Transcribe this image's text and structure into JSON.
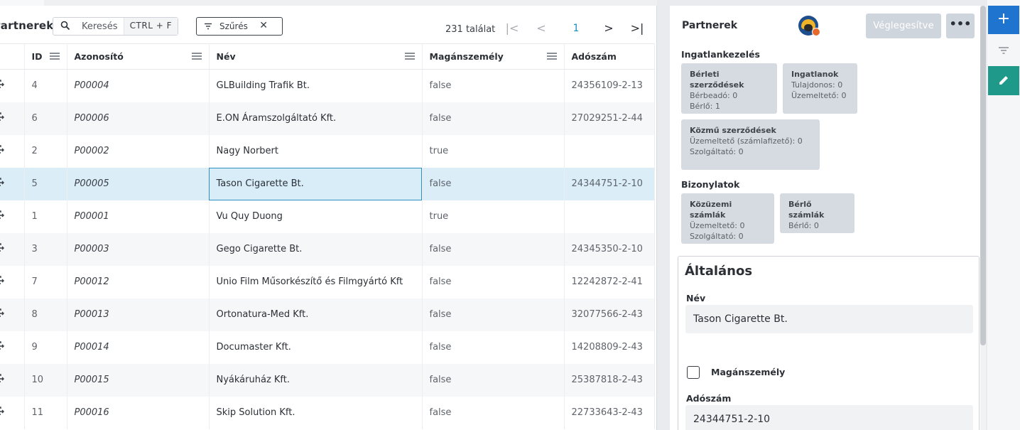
{
  "left": {
    "title": "Partnerek",
    "search": {
      "placeholder": "Keresés",
      "shortcut": "CTRL + F"
    },
    "filter_label": "Szűrés",
    "result_count": "231 találat",
    "current_page": "1",
    "columns": [
      "ID",
      "Azonosító",
      "Név",
      "Magánszemély",
      "Adószám"
    ],
    "rows": [
      {
        "id": "4",
        "code": "P00004",
        "name": "GLBuilding Trafik Bt.",
        "private": "false",
        "tax": "24356109-2-13"
      },
      {
        "id": "6",
        "code": "P00006",
        "name": "E.ON Áramszolgáltató Kft.",
        "private": "false",
        "tax": "27029251-2-44"
      },
      {
        "id": "2",
        "code": "P00002",
        "name": "Nagy Norbert",
        "private": "true",
        "tax": ""
      },
      {
        "id": "5",
        "code": "P00005",
        "name": "Tason Cigarette Bt.",
        "private": "false",
        "tax": "24344751-2-10"
      },
      {
        "id": "1",
        "code": "P00001",
        "name": "Vu Quy Duong",
        "private": "true",
        "tax": ""
      },
      {
        "id": "3",
        "code": "P00003",
        "name": "Gego Cigarette Bt.",
        "private": "false",
        "tax": "24345350-2-10"
      },
      {
        "id": "7",
        "code": "P00012",
        "name": "Unio Film Műsorkészítő és Filmgyártó Kft",
        "private": "false",
        "tax": "12242872-2-41"
      },
      {
        "id": "8",
        "code": "P00013",
        "name": "Ortonatura-Med Kft.",
        "private": "false",
        "tax": "32077566-2-43"
      },
      {
        "id": "9",
        "code": "P00014",
        "name": "Documaster Kft.",
        "private": "false",
        "tax": "14208809-2-43"
      },
      {
        "id": "10",
        "code": "P00015",
        "name": "Nyákáruház Kft.",
        "private": "false",
        "tax": "25387818-2-43"
      },
      {
        "id": "11",
        "code": "P00016",
        "name": "Skip Solution Kft.",
        "private": "false",
        "tax": "22733643-2-43"
      }
    ]
  },
  "right": {
    "title": "Partnerek",
    "finalize_label": "Véglegesítve",
    "more_label": "•••",
    "property_section": "Ingatlankezelés",
    "cards_property": [
      {
        "title": "Bérleti szerződések",
        "lines": [
          "Bérbeadó: 0",
          "Bérlő: 1"
        ]
      },
      {
        "title": "Ingatlanok",
        "lines": [
          "Tulajdonos: 0",
          "Üzemeltető: 0"
        ]
      },
      {
        "title": "Közmű szerződések",
        "lines": [
          "Üzemeltető (számlafizető): 0",
          "Szolgáltató: 0"
        ]
      }
    ],
    "docs_section": "Bizonylatok",
    "cards_docs": [
      {
        "title": "Közüzemi számlák",
        "lines": [
          "Üzemeltető: 0",
          "Szolgáltató: 0"
        ]
      },
      {
        "title": "Bérlő számlák",
        "lines": [
          "Bérlő: 0"
        ]
      }
    ],
    "general": {
      "title": "Általános",
      "name_label": "Név",
      "name_value": "Tason Cigarette Bt.",
      "private_label": "Magánszemély",
      "tax_label": "Adószám",
      "tax_value": "24344751-2-10"
    }
  },
  "rail": {
    "add_label": "+"
  },
  "colors": {
    "accent": "#1f8cc5",
    "selected_row": "#dbeef8",
    "rail_add": "#1f74d0",
    "rail_edit": "#1f9a8a",
    "card": "#d6dbe1"
  },
  "icons": [
    "search-icon",
    "filter-icon",
    "close-icon",
    "first-page-icon",
    "prev-page-icon",
    "next-page-icon",
    "last-page-icon",
    "column-menu-icon",
    "row-open-icon",
    "avatar",
    "add-icon",
    "edit-icon"
  ]
}
